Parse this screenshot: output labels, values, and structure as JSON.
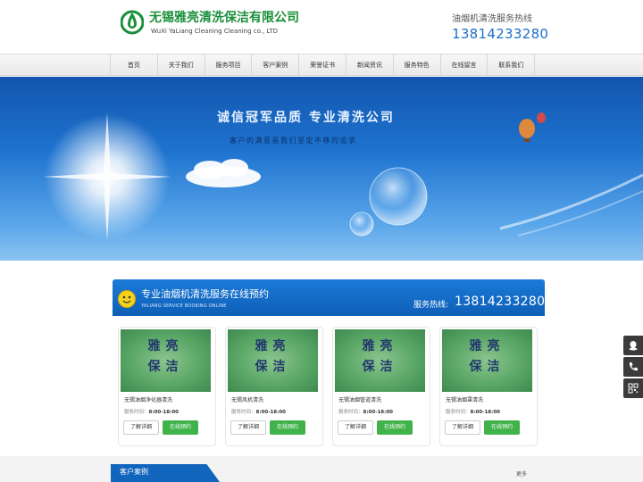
{
  "header": {
    "company_cn": "无锡雅亮清洗保洁有限公司",
    "company_en": "WuXi YaLiang Cleaning Cleaning co., LTD",
    "hotline_label": "油烟机清洗服务热线",
    "hotline_number": "13814233280"
  },
  "nav": {
    "items": [
      "首页",
      "关于我们",
      "服务项目",
      "客户案例",
      "荣誉证书",
      "新闻资讯",
      "服务特色",
      "在线留言",
      "联系我们"
    ]
  },
  "banner": {
    "title": "诚信冠军品质    专业清洗公司",
    "subtitle": "客户的满意是我们坚定不移的追求"
  },
  "booking": {
    "title": "专业油烟机清洗服务在线预约",
    "subtitle_en": "YALIANG SERVICE BOOKING ONLINE",
    "tel_label": "服务热线:",
    "tel_number": "13814233280",
    "cards": [
      {
        "image_text_1": "雅亮",
        "image_text_2": "保洁",
        "name": "无锡油烟净化器清洗",
        "time_label": "服务时间：",
        "time_value": "8:00-18:00",
        "detail_label": "了解详细",
        "book_label": "在线预约"
      },
      {
        "image_text_1": "雅亮",
        "image_text_2": "保洁",
        "name": "无锡风机清洗",
        "time_label": "服务时间：",
        "time_value": "8:00-18:00",
        "detail_label": "了解详细",
        "book_label": "在线预约"
      },
      {
        "image_text_1": "雅亮",
        "image_text_2": "保洁",
        "name": "无锡油烟管道清洗",
        "time_label": "服务时间：",
        "time_value": "8:00-18:00",
        "detail_label": "了解详细",
        "book_label": "在线预约"
      },
      {
        "image_text_1": "雅亮",
        "image_text_2": "保洁",
        "name": "无锡油烟罩清洗",
        "time_label": "服务时间：",
        "time_value": "8:00-18:00",
        "detail_label": "了解详细",
        "book_label": "在线预约"
      }
    ]
  },
  "cases": {
    "title": "客户案例",
    "more_label": "更多"
  },
  "side_tools": {
    "icons": [
      "qq-icon",
      "phone-icon",
      "qrcode-icon"
    ]
  },
  "colors": {
    "brand_green": "#1a8f3a",
    "brand_blue": "#1265bd",
    "book_green": "#3fb34a"
  }
}
